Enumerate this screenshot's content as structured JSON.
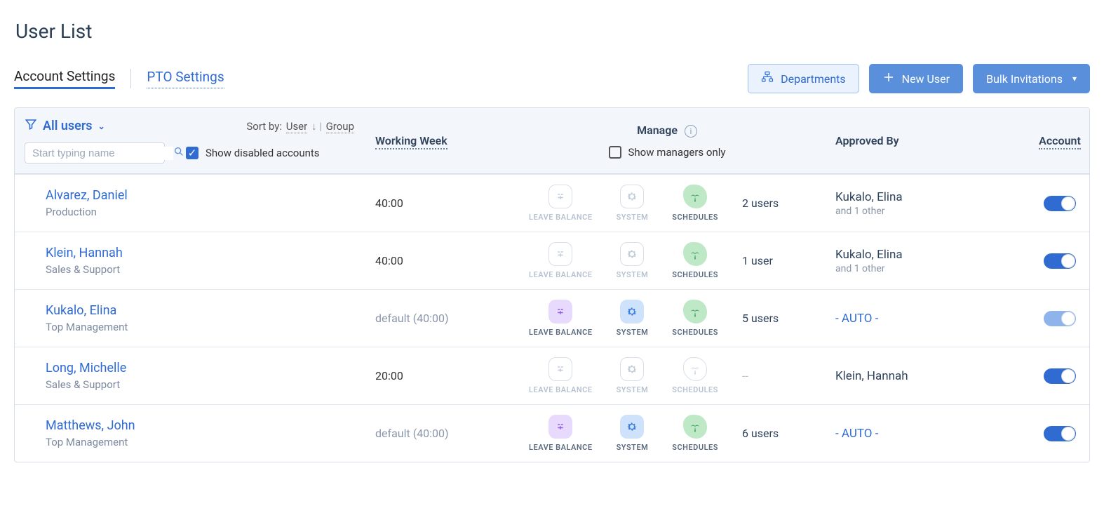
{
  "page": {
    "title": "User List"
  },
  "tabs": {
    "account": "Account Settings",
    "pto": "PTO Settings",
    "active": "account"
  },
  "buttons": {
    "departments": "Departments",
    "newUser": "New User",
    "bulk": "Bulk Invitations"
  },
  "filter": {
    "allUsers": "All users",
    "sortByLabel": "Sort by:",
    "sortUser": "User",
    "sortGroup": "Group",
    "searchPlaceholder": "Start typing name",
    "showDisabled": "Show disabled accounts",
    "showDisabledChecked": true
  },
  "headers": {
    "workingWeek": "Working Week",
    "manage": "Manage",
    "managersOnly": "Show managers only",
    "approvedBy": "Approved By",
    "account": "Account"
  },
  "mgLabels": {
    "leave": "LEAVE BALANCE",
    "system": "SYSTEM",
    "schedules": "SCHEDULES"
  },
  "placeholders": {
    "dash": "--",
    "auto": "- AUTO -",
    "andOther": "and 1 other"
  },
  "users": [
    {
      "name": "Alvarez, Daniel",
      "dept": "Production",
      "ww": "40:00",
      "wwDefault": false,
      "leave": false,
      "system": false,
      "schedules": true,
      "count": "2 users",
      "approvedBy": {
        "name": "Kukalo, Elina",
        "extra": true
      },
      "toggle": "on"
    },
    {
      "name": "Klein, Hannah",
      "dept": "Sales & Support",
      "ww": "40:00",
      "wwDefault": false,
      "leave": false,
      "system": false,
      "schedules": true,
      "count": "1 user",
      "approvedBy": {
        "name": "Kukalo, Elina",
        "extra": true
      },
      "toggle": "on"
    },
    {
      "name": "Kukalo, Elina",
      "dept": "Top Management",
      "ww": "default (40:00)",
      "wwDefault": true,
      "leave": true,
      "system": true,
      "schedules": true,
      "count": "5 users",
      "approvedBy": {
        "auto": true
      },
      "toggle": "muted"
    },
    {
      "name": "Long, Michelle",
      "dept": "Sales & Support",
      "ww": "20:00",
      "wwDefault": false,
      "leave": false,
      "system": false,
      "schedules": false,
      "count": "--",
      "approvedBy": {
        "name": "Klein, Hannah"
      },
      "toggle": "on"
    },
    {
      "name": "Matthews, John",
      "dept": "Top Management",
      "ww": "default (40:00)",
      "wwDefault": true,
      "leave": true,
      "system": true,
      "schedules": true,
      "count": "6 users",
      "approvedBy": {
        "auto": true
      },
      "toggle": "on"
    }
  ]
}
